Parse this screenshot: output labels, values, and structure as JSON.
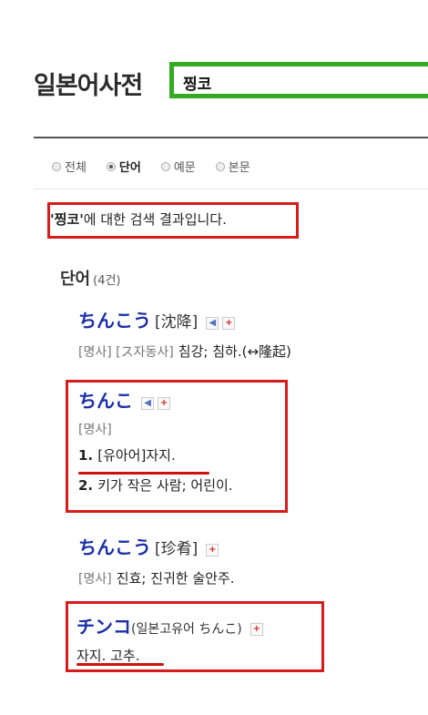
{
  "header": {
    "title": "일본어사전",
    "search_value": "찡코"
  },
  "filters": [
    {
      "label": "전체",
      "selected": false
    },
    {
      "label": "단어",
      "selected": true
    },
    {
      "label": "예문",
      "selected": false
    },
    {
      "label": "본문",
      "selected": false
    }
  ],
  "summary": {
    "query_quoted": "'찡코'",
    "text": "에 대한 검색 결과입니다."
  },
  "section": {
    "title": "단어",
    "count": "(4건)"
  },
  "entries": [
    {
      "headword": "ちんこう",
      "kanji": "[沈降]",
      "pos": "[명사] [ス자동사]",
      "definition": "침강; 침하.(↔隆起)"
    },
    {
      "headword": "ちんこ",
      "pos": "[명사]",
      "def1_num": "1.",
      "def1": "[유아어]자지.",
      "def2_num": "2.",
      "def2": "키가 작은 사람; 어린이."
    },
    {
      "headword": "ちんこう",
      "kanji": "[珍肴]",
      "pos": "[명사]",
      "definition": "진효; 진귀한 술안주."
    },
    {
      "headword": "チンコ",
      "origin": "(일본고유어 ちんこ)",
      "definition": "자지. 고추."
    }
  ],
  "icons": {
    "sound": "speaker-icon",
    "add": "plus-icon"
  },
  "colors": {
    "search_border": "#33aa22",
    "highlight_box": "#d81c1c",
    "headword": "#1a2fa8"
  }
}
